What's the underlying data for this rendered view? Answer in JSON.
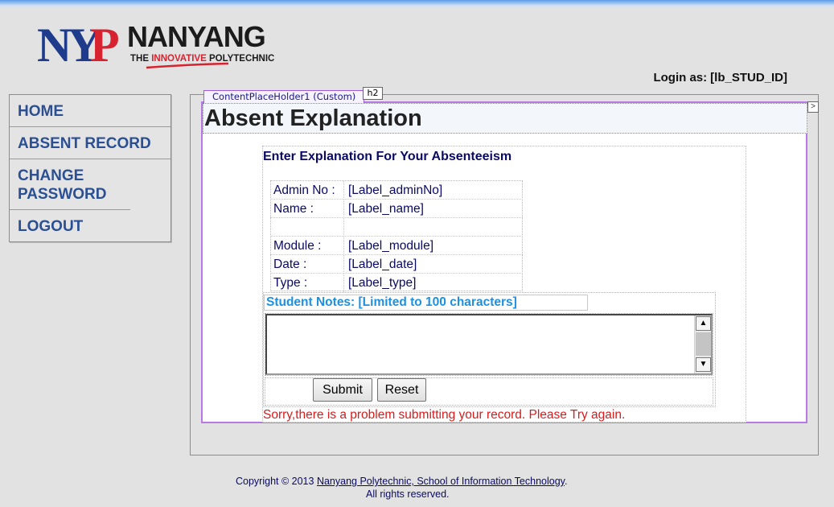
{
  "logo": {
    "mark": "NYP",
    "name": "NANYANG",
    "tagline_prefix": "THE ",
    "tagline_highlight": "INNOVATIVE",
    "tagline_suffix": " POLYTECHNIC",
    "colors": {
      "navy": "#1f3c8c",
      "red": "#d7232f"
    }
  },
  "header": {
    "login_label": "Login as:",
    "login_value": "[lb_STUD_ID]"
  },
  "sidebar": {
    "items": [
      {
        "label": "HOME"
      },
      {
        "label": "ABSENT RECORD"
      },
      {
        "label": "CHANGE PASSWORD"
      },
      {
        "label": "LOGOUT"
      }
    ]
  },
  "designer": {
    "placeholder_tab": "ContentPlaceHolder1 (Custom)",
    "heading_tag": "h2",
    "expand_glyph": ">"
  },
  "main": {
    "title": "Absent Explanation",
    "form_title": "Enter Explanation For Your Absenteeism",
    "info": [
      {
        "label": "Admin No :",
        "value": "[Label_adminNo]"
      },
      {
        "label": "Name :",
        "value": "[Label_name]"
      },
      {
        "label": "",
        "value": ""
      },
      {
        "label": "Module :",
        "value": "[Label_module]"
      },
      {
        "label": "Date :",
        "value": "[Label_date]"
      },
      {
        "label": "Type :",
        "value": "[Label_type]"
      }
    ],
    "notes_label": "Student Notes:  [Limited to 100 characters]",
    "notes_value": "",
    "submit_label": "Submit",
    "reset_label": "Reset",
    "error_message": "Sorry,there is a problem submitting your record. Please Try again."
  },
  "footer": {
    "copyright_prefix": "Copyright © 2013 ",
    "link_text": "Nanyang Polytechnic, School of Information Technology",
    "suffix": ".",
    "line2": "All rights reserved."
  }
}
